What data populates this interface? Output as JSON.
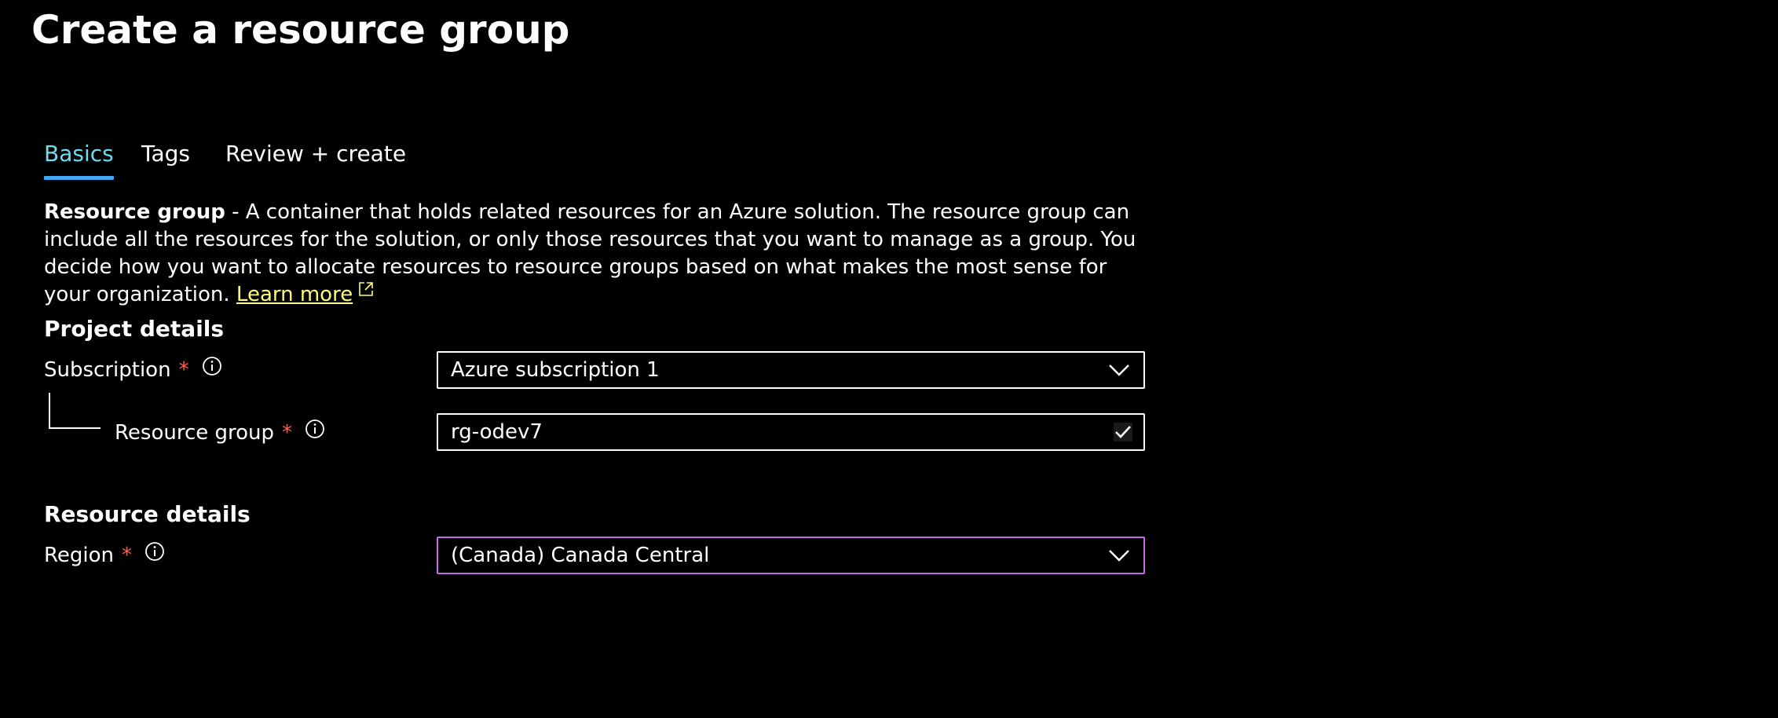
{
  "header": {
    "title": "Create a resource group",
    "more_label": "···"
  },
  "tabs": [
    {
      "label": "Basics",
      "active": true
    },
    {
      "label": "Tags",
      "active": false
    },
    {
      "label": "Review + create",
      "active": false
    }
  ],
  "description": {
    "bold_term": "Resource group",
    "text": " - A container that holds related resources for an Azure solution. The resource group can include all the resources for the solution, or only those resources that you want to manage as a group. You decide how you want to allocate resources to resource groups based on what makes the most sense for your organization. ",
    "learn_more": "Learn more"
  },
  "project_details": {
    "title": "Project details",
    "subscription": {
      "label": "Subscription",
      "required_mark": "*",
      "value": "Azure subscription 1"
    },
    "resource_group": {
      "label": "Resource group",
      "required_mark": "*",
      "value": "rg-odev7"
    }
  },
  "resource_details": {
    "title": "Resource details",
    "region": {
      "label": "Region",
      "required_mark": "*",
      "value": "(Canada) Canada Central"
    }
  },
  "icons": {
    "more": "more-icon",
    "info": "info-icon",
    "external": "external-link-icon",
    "chevron": "chevron-down-icon",
    "check": "check-icon"
  },
  "colors": {
    "background": "#000000",
    "active_tab_text": "#6fdcf0",
    "active_tab_underline": "#3da9f5",
    "link": "#ffff70",
    "required": "#ff5b5b",
    "focus_border": "#c46de8"
  }
}
